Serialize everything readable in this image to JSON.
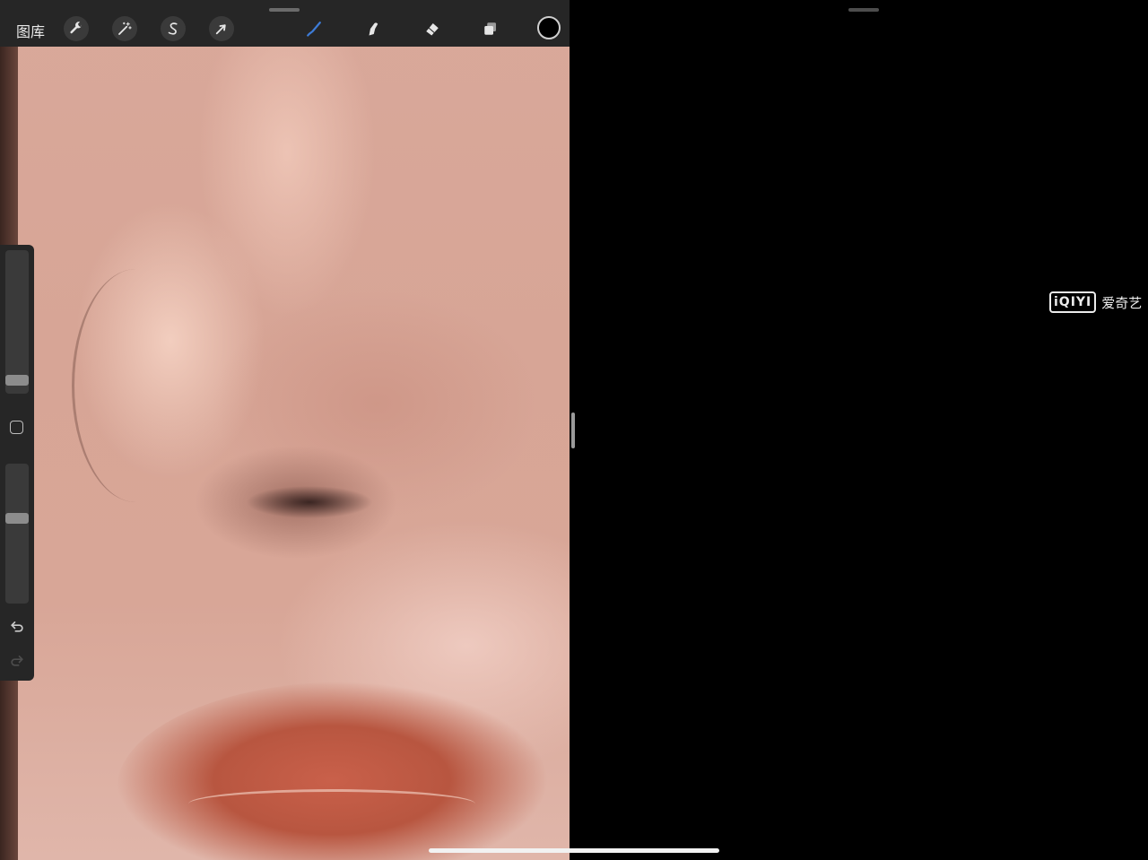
{
  "toolbar": {
    "gallery_label": "图库",
    "left_tools": [
      {
        "name": "actions",
        "icon": "wrench-icon"
      },
      {
        "name": "adjustments",
        "icon": "magic-wand-icon"
      },
      {
        "name": "selection",
        "icon": "selection-s-icon"
      },
      {
        "name": "transform",
        "icon": "arrow-cursor-icon"
      }
    ],
    "right_tools": [
      {
        "name": "brush",
        "icon": "brush-icon",
        "active": true
      },
      {
        "name": "smudge",
        "icon": "smudge-finger-icon"
      },
      {
        "name": "eraser",
        "icon": "eraser-icon"
      },
      {
        "name": "layers",
        "icon": "layers-icon"
      },
      {
        "name": "color",
        "icon": "color-circle-icon",
        "color": "#000000"
      }
    ],
    "accent_color": "#3d7bd6"
  },
  "sidebar": {
    "brush_size_level": 0.1,
    "opacity_level": 0.6,
    "buttons": [
      "modify-button",
      "undo-button",
      "redo-button"
    ]
  },
  "watermark": {
    "logo_text": "iQIYI",
    "label": "爱奇艺"
  }
}
